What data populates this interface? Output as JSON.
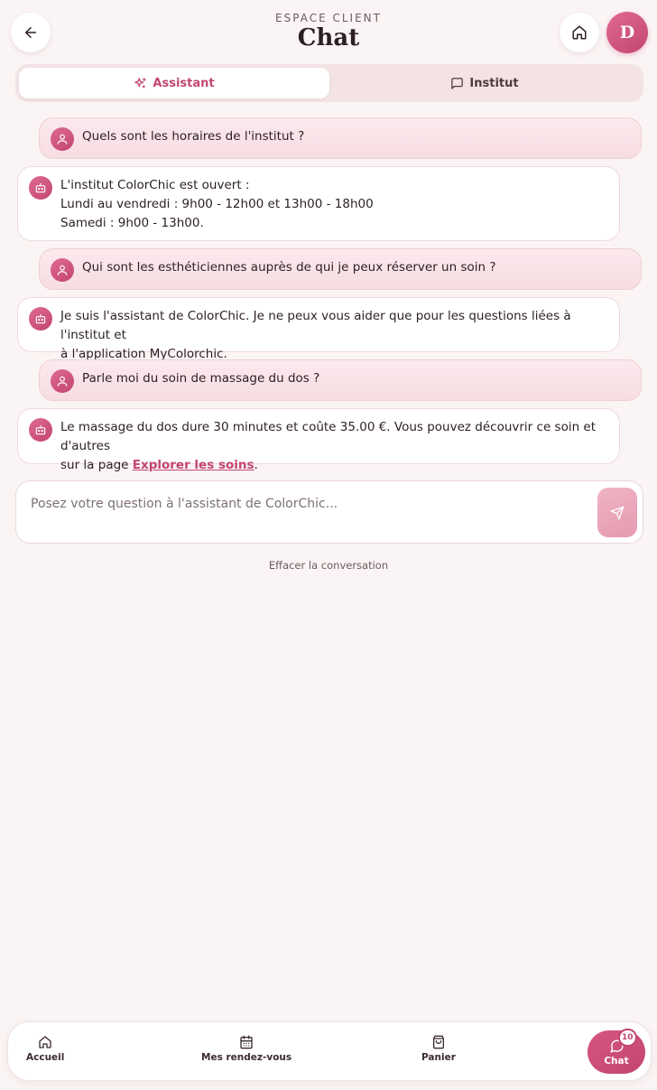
{
  "header": {
    "eyebrow": "ESPACE CLIENT",
    "title": "Chat",
    "avatar_initial": "D"
  },
  "tabs": [
    {
      "label": "Assistant",
      "active": true,
      "icon": "sparkles-icon"
    },
    {
      "label": "Institut",
      "active": false,
      "icon": "message-square-icon"
    }
  ],
  "messages": [
    {
      "role": "user",
      "lines": [
        "Quels sont les horaires de l'institut ?"
      ]
    },
    {
      "role": "bot",
      "lines": [
        "L'institut ColorChic est ouvert :",
        "Lundi au vendredi : 9h00 - 12h00 et 13h00 - 18h00",
        "Samedi : 9h00 - 13h00."
      ]
    },
    {
      "role": "user",
      "lines": [
        "Qui sont les esthéticiennes auprès de qui je peux réserver un soin ?"
      ]
    },
    {
      "role": "bot",
      "lines": [
        "Je suis l'assistant de ColorChic. Je ne peux vous aider que pour les questions liées à l'institut et",
        "à l'application MyColorchic."
      ]
    },
    {
      "role": "user",
      "lines": [
        "Parle moi du soin de massage du dos ?"
      ]
    },
    {
      "role": "bot",
      "lines": [
        "Le massage du dos dure 30 minutes et coûte 35.00 €. Vous pouvez découvrir ce soin et d'autres"
      ],
      "link_prefix": "sur la page ",
      "link_text": "Explorer les soins",
      "link_suffix": "."
    }
  ],
  "composer": {
    "placeholder": "Posez votre question à l'assistant de ColorChic...",
    "value": ""
  },
  "clear_label": "Effacer la conversation",
  "bottom_nav": {
    "items": [
      {
        "label": "Accueil",
        "icon": "home-icon"
      },
      {
        "label": "Mes rendez-vous",
        "icon": "calendar-icon"
      },
      {
        "label": "Panier",
        "icon": "shopping-bag-icon"
      },
      {
        "label": "Chat",
        "icon": "chat-icon",
        "active": true
      }
    ],
    "chat_badge": "10"
  },
  "colors": {
    "accent": "#c2466f",
    "background": "#fbf4f4",
    "user_bubble": "#f9e3e8"
  }
}
